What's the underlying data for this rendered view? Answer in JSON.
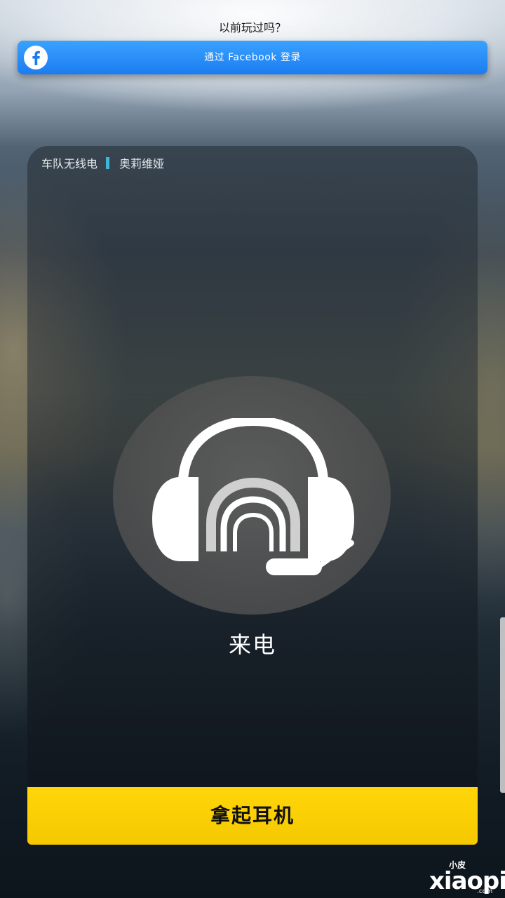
{
  "header": {
    "question": "以前玩过吗？",
    "facebook_button": {
      "label": "通过 Facebook 登录",
      "icon": "facebook-icon",
      "color": "#2a8cf7"
    }
  },
  "radio_card": {
    "channel": "车队无线电",
    "caller": "奥莉维娅",
    "divider_color": "#3fb6d8",
    "icon": "headset-icon",
    "status": "来电"
  },
  "pickup_button": {
    "label": "拿起耳机",
    "color": "#ffd60a"
  },
  "watermark": {
    "small": "小皮",
    "big": "xiaopi",
    "url": ".com"
  }
}
